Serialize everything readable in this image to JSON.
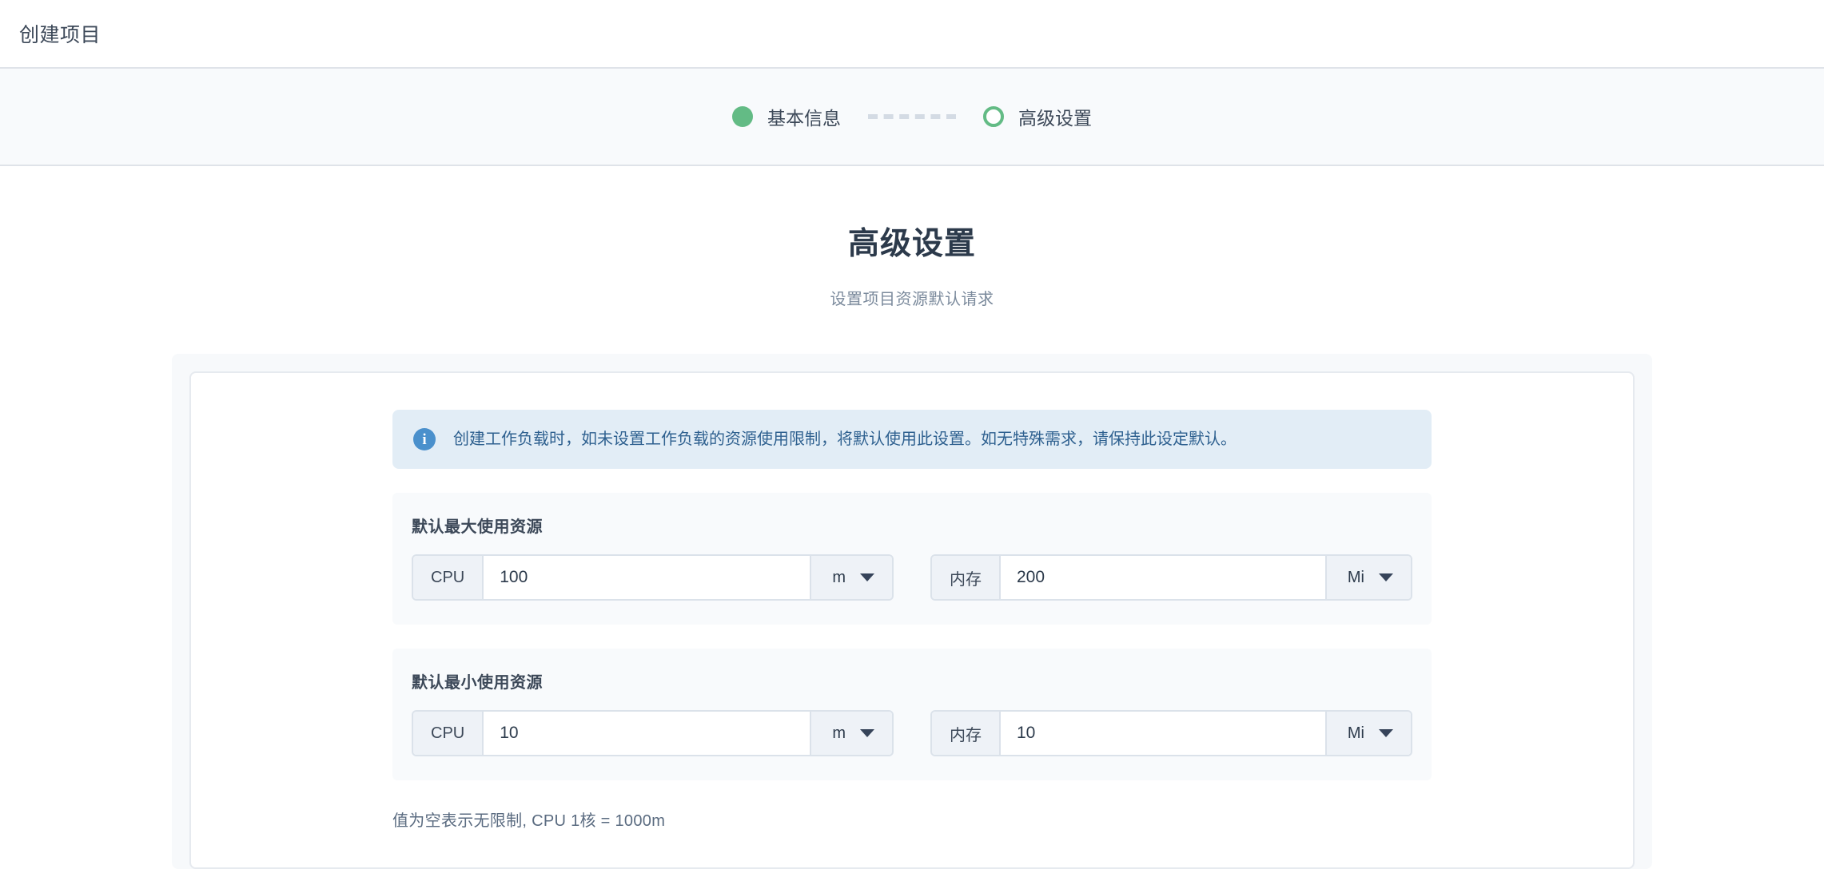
{
  "window": {
    "title": "创建项目"
  },
  "stepper": {
    "steps": [
      {
        "label": "基本信息",
        "state": "done"
      },
      {
        "label": "高级设置",
        "state": "current"
      }
    ]
  },
  "main": {
    "heading": "高级设置",
    "subheading": "设置项目资源默认请求",
    "info_banner": {
      "icon": "info-icon",
      "text": "创建工作负载时，如未设置工作负载的资源使用限制，将默认使用此设置。如无特殊需求，请保持此设定默认。"
    },
    "groups": [
      {
        "title": "默认最大使用资源",
        "fields": [
          {
            "prefix": "CPU",
            "value": "100",
            "placeholder": "",
            "unit": "m"
          },
          {
            "prefix": "内存",
            "value": "200",
            "placeholder": "",
            "unit": "Mi"
          }
        ]
      },
      {
        "title": "默认最小使用资源",
        "fields": [
          {
            "prefix": "CPU",
            "value": "10",
            "placeholder": "",
            "unit": "m"
          },
          {
            "prefix": "内存",
            "value": "10",
            "placeholder": "",
            "unit": "Mi"
          }
        ]
      }
    ],
    "hint": "值为空表示无限制, CPU 1核 = 1000m"
  },
  "colors": {
    "step_active": "#63bb85",
    "info_icon": "#4a90cc",
    "info_bg": "#e2edf6",
    "info_text": "#2f6190",
    "band_bg": "#f8fafc",
    "border": "#dfe3e9"
  }
}
